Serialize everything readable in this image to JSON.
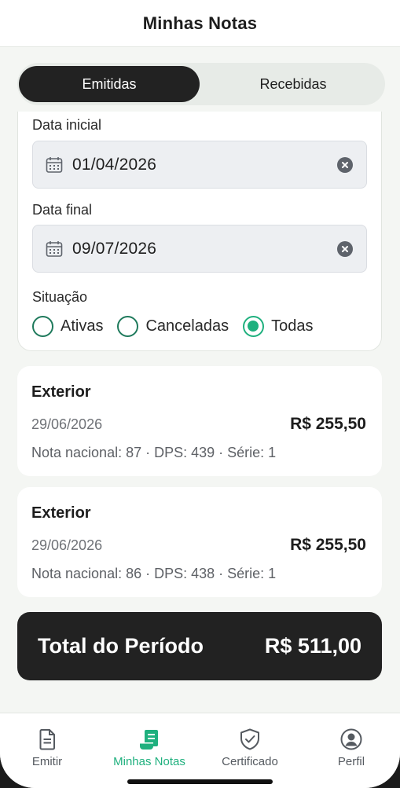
{
  "header": {
    "title": "Minhas Notas"
  },
  "segments": {
    "issued": "Emitidas",
    "received": "Recebidas",
    "active": "Emitidas"
  },
  "filters": {
    "start_label": "Data inicial",
    "start_value": "01/04/2026",
    "end_label": "Data final",
    "end_value": "09/07/2026",
    "status_label": "Situação",
    "status_options": [
      "Ativas",
      "Canceladas",
      "Todas"
    ],
    "status_selected": "Todas"
  },
  "notes": [
    {
      "kind": "Exterior",
      "date": "29/06/2026",
      "amount": "R$ 255,50",
      "meta": "Nota nacional: 87 · DPS: 439 · Série: 1"
    },
    {
      "kind": "Exterior",
      "date": "29/06/2026",
      "amount": "R$ 255,50",
      "meta": "Nota nacional: 86 · DPS: 438 · Série: 1"
    }
  ],
  "total": {
    "label": "Total do Período",
    "value": "R$ 511,00"
  },
  "tabbar": {
    "items": [
      {
        "label": "Emitir",
        "icon": "document-icon"
      },
      {
        "label": "Minhas Notas",
        "icon": "receipt-list-icon"
      },
      {
        "label": "Certificado",
        "icon": "shield-check-icon"
      },
      {
        "label": "Perfil",
        "icon": "user-circle-icon"
      }
    ],
    "active": "Minhas Notas"
  },
  "colors": {
    "accent": "#1fb07e",
    "dark": "#222222",
    "background": "#f4f6f3"
  }
}
